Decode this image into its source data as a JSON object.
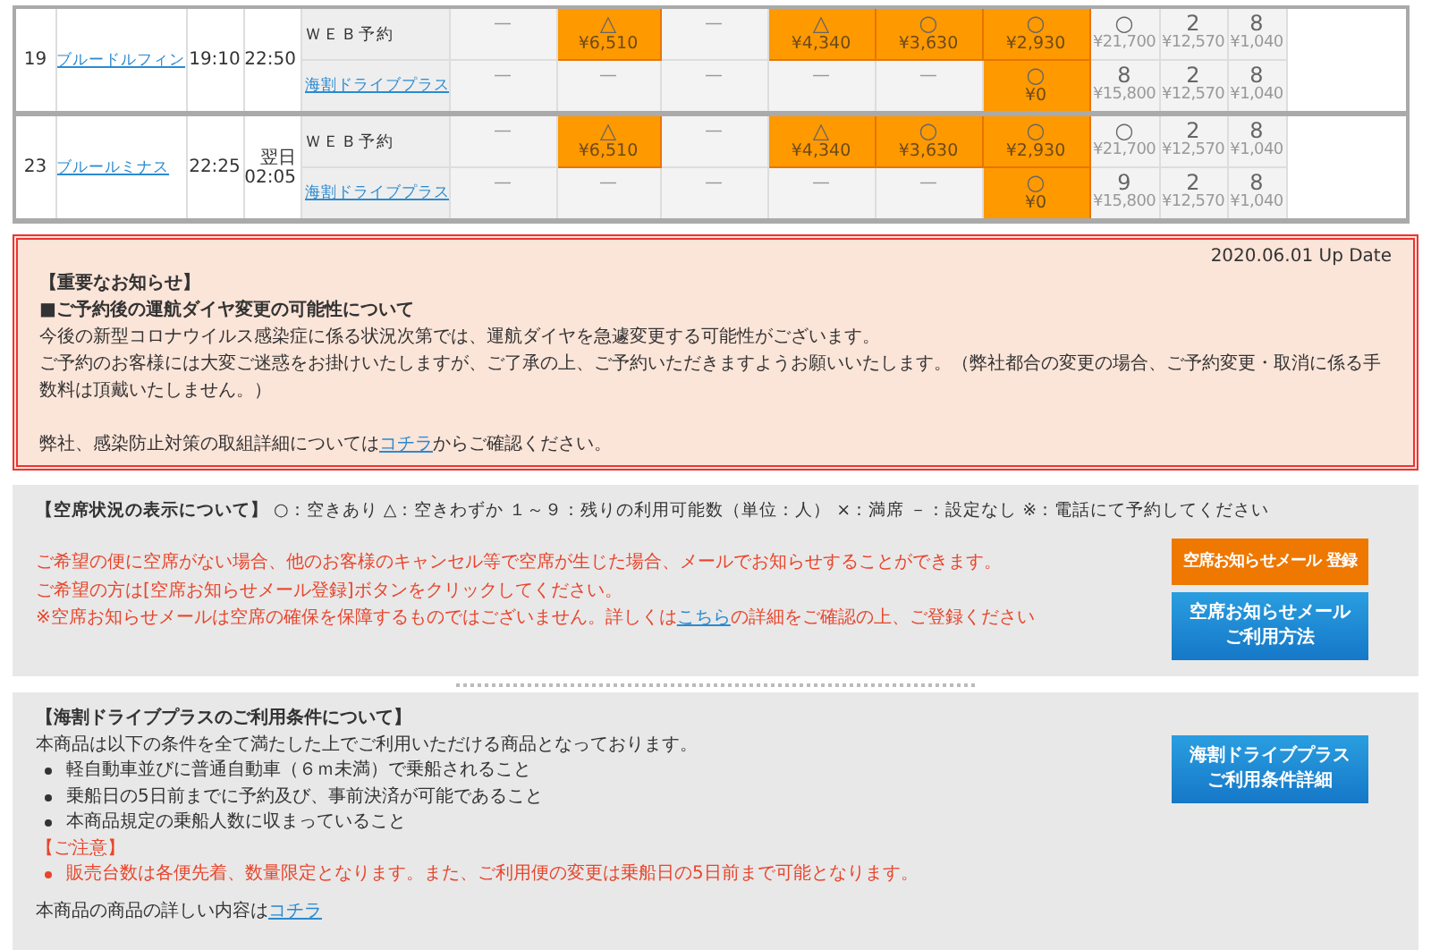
{
  "schedule": {
    "rows": [
      {
        "no": "19",
        "ship": "ブルードルフィン",
        "departure": "19:10",
        "arrival_prefix": null,
        "arrival": "22:50",
        "plans": [
          {
            "name": "ＷＥＢ予約",
            "link": false,
            "cells": [
              {
                "kind": "dash",
                "mark": "—"
              },
              {
                "kind": "fare",
                "mark": "△",
                "price": "¥6,510",
                "highlighted": true
              },
              {
                "kind": "dash",
                "mark": "—"
              },
              {
                "kind": "fare",
                "mark": "△",
                "price": "¥4,340",
                "highlighted": true
              },
              {
                "kind": "fare",
                "mark": "○",
                "price": "¥3,630",
                "highlighted": true
              },
              {
                "kind": "fare",
                "mark": "○",
                "price": "¥2,930",
                "highlighted": true
              },
              {
                "kind": "fare",
                "mark": "○",
                "price": "¥21,700",
                "highlighted": false
              },
              {
                "kind": "fare",
                "mark": "2",
                "price": "¥12,570",
                "highlighted": false
              },
              {
                "kind": "fare",
                "mark": "8",
                "price": "¥1,040",
                "highlighted": false
              }
            ]
          },
          {
            "name": "海割ドライブプラス",
            "link": true,
            "cells": [
              {
                "kind": "dash",
                "mark": "—"
              },
              {
                "kind": "dash",
                "mark": "—"
              },
              {
                "kind": "dash",
                "mark": "—"
              },
              {
                "kind": "dash",
                "mark": "—"
              },
              {
                "kind": "dash",
                "mark": "—"
              },
              {
                "kind": "fare",
                "mark": "○",
                "price": "¥0",
                "highlighted": true
              },
              {
                "kind": "fare",
                "mark": "8",
                "price": "¥15,800",
                "highlighted": false
              },
              {
                "kind": "fare",
                "mark": "2",
                "price": "¥12,570",
                "highlighted": false
              },
              {
                "kind": "fare",
                "mark": "8",
                "price": "¥1,040",
                "highlighted": false
              }
            ]
          }
        ]
      },
      {
        "no": "23",
        "ship": "ブルールミナス",
        "departure": "22:25",
        "arrival_prefix": "翌日",
        "arrival": "02:05",
        "plans": [
          {
            "name": "ＷＥＢ予約",
            "link": false,
            "cells": [
              {
                "kind": "dash",
                "mark": "—"
              },
              {
                "kind": "fare",
                "mark": "△",
                "price": "¥6,510",
                "highlighted": true
              },
              {
                "kind": "dash",
                "mark": "—"
              },
              {
                "kind": "fare",
                "mark": "△",
                "price": "¥4,340",
                "highlighted": true
              },
              {
                "kind": "fare",
                "mark": "○",
                "price": "¥3,630",
                "highlighted": true
              },
              {
                "kind": "fare",
                "mark": "○",
                "price": "¥2,930",
                "highlighted": true
              },
              {
                "kind": "fare",
                "mark": "○",
                "price": "¥21,700",
                "highlighted": false
              },
              {
                "kind": "fare",
                "mark": "2",
                "price": "¥12,570",
                "highlighted": false
              },
              {
                "kind": "fare",
                "mark": "8",
                "price": "¥1,040",
                "highlighted": false
              }
            ]
          },
          {
            "name": "海割ドライブプラス",
            "link": true,
            "cells": [
              {
                "kind": "dash",
                "mark": "—"
              },
              {
                "kind": "dash",
                "mark": "—"
              },
              {
                "kind": "dash",
                "mark": "—"
              },
              {
                "kind": "dash",
                "mark": "—"
              },
              {
                "kind": "dash",
                "mark": "—"
              },
              {
                "kind": "fare",
                "mark": "○",
                "price": "¥0",
                "highlighted": true
              },
              {
                "kind": "fare",
                "mark": "9",
                "price": "¥15,800",
                "highlighted": false
              },
              {
                "kind": "fare",
                "mark": "2",
                "price": "¥12,570",
                "highlighted": false
              },
              {
                "kind": "fare",
                "mark": "8",
                "price": "¥1,040",
                "highlighted": false
              }
            ]
          }
        ]
      }
    ]
  },
  "notice": {
    "date": "2020.06.01 Up Date",
    "heading": "【重要なお知らせ】",
    "subheading": "■ご予約後の運航ダイヤ変更の可能性について",
    "paragraphs": [
      "今後の新型コロナウイルス感染症に係る状況次第では、運航ダイヤを急遽変更する可能性がございます。",
      "ご予約のお客様には大変ご迷惑をお掛けいたしますが、ご了承の上、ご予約いただきますようお願いいたします。（弊社都合の変更の場合、ご予約変更・取消に係る手数料は頂戴いたしません。）"
    ],
    "link_line": {
      "before": "弊社、感染防止対策の取組詳細については",
      "link": "コチラ",
      "after": "からご確認ください。"
    }
  },
  "availability": {
    "legend": "**【空席状況の表示について】** ○：空きあり △：空きわずか １～９：残りの利用可能数（単位：人） ×：満席 －：設定なし ※：電話にて予約してください",
    "lines": [
      "ご希望の便に空席がない場合、他のお客様のキャンセル等で空席が生じた場合、メールでお知らせすることができます。",
      "ご希望の方は[空席お知らせメール登録]ボタンをクリックしてください。"
    ],
    "last_line": {
      "before": "※空席お知らせメールは空席の確保を保障するものではございません。詳しくは",
      "link": "こちら",
      "after": "の詳細をご確認の上、ご登録ください"
    },
    "buttons": [
      {
        "kind": "orange",
        "lines": [
          "空席お知らせメール 登録"
        ]
      },
      {
        "kind": "blue",
        "lines": [
          "空席お知らせメール",
          "ご利用方法"
        ]
      }
    ]
  },
  "conditions": {
    "title": "【海割ドライブプラスのご利用条件について】",
    "intro": "本商品は以下の条件を全て満たした上でご利用いただける商品となっております。",
    "items": [
      "軽自動車並びに普通自動車（６ｍ未満）で乗船されること",
      "乗船日の5日前までに予約及び、事前決済が可能であること",
      "本商品規定の乗船人数に収まっていること"
    ],
    "caution_title": "【ご注意】",
    "caution_items": [
      "販売台数は各便先着、数量限定となります。また、ご利用便の変更は乗船日の5日前まで可能となります。"
    ],
    "footer": {
      "before": "本商品の商品の詳しい内容は",
      "link": "コチラ"
    },
    "button": [
      "海割ドライブプラス",
      "ご利用条件詳細"
    ]
  }
}
